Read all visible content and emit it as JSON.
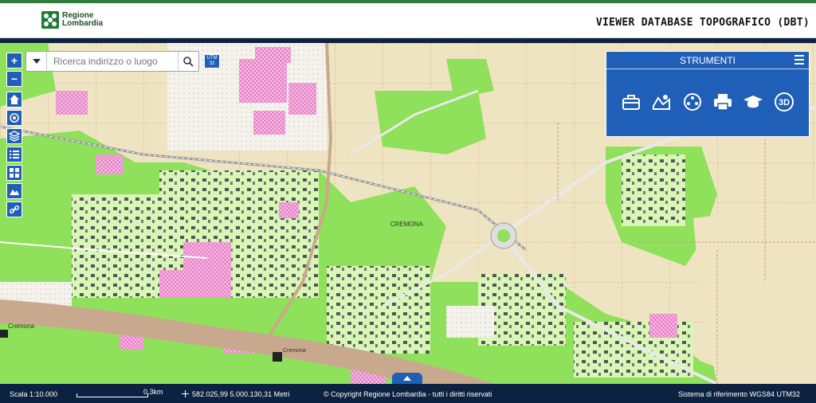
{
  "header": {
    "logo_line1": "Regione",
    "logo_line2": "Lombardia",
    "title": "VIEWER DATABASE TOPOGRAFICO (DBT)"
  },
  "search": {
    "placeholder": "Ricerca indirizzo o luogo"
  },
  "utm_badge": {
    "line1": "UTM",
    "line2": "32"
  },
  "left_tools": [
    {
      "name": "zoom-in-button",
      "label": "+"
    },
    {
      "name": "zoom-out-button",
      "label": "−"
    },
    {
      "name": "home-button",
      "icon": "home-icon"
    },
    {
      "name": "locate-button",
      "icon": "target-icon"
    },
    {
      "name": "layers-button",
      "icon": "layers-icon"
    },
    {
      "name": "legend-button",
      "icon": "list-icon"
    },
    {
      "name": "basemap-button",
      "icon": "grid-icon"
    },
    {
      "name": "profile-button",
      "icon": "mountain-icon"
    },
    {
      "name": "link-button",
      "icon": "link-icon"
    }
  ],
  "tools_panel": {
    "title": "STRUMENTI",
    "tools": [
      "toolbox-icon",
      "map-measure-icon",
      "network-icon",
      "print-icon",
      "graduation-cap-icon",
      "3d-icon"
    ],
    "label_3d": "3D"
  },
  "map": {
    "place_labels": [
      "CREMONA",
      "Cremona",
      "Cremona"
    ]
  },
  "footer": {
    "scale": "Scala 1:10.000",
    "scalebar_label": "0.3km",
    "coords": "582.025,99 5.000.130,31 Metri",
    "copyright": "© Copyright Regione Lombardia - tutti i diritti riservati",
    "crs": "Sistema di riferimento WGS84 UTM32"
  },
  "colors": {
    "brand_green": "#1f7a37",
    "navy": "#0c2240",
    "tool_blue": "#1f5fb8",
    "map_field": "#efe6c8",
    "map_green": "#8fe05a",
    "map_pink": "#f0a8d8"
  }
}
